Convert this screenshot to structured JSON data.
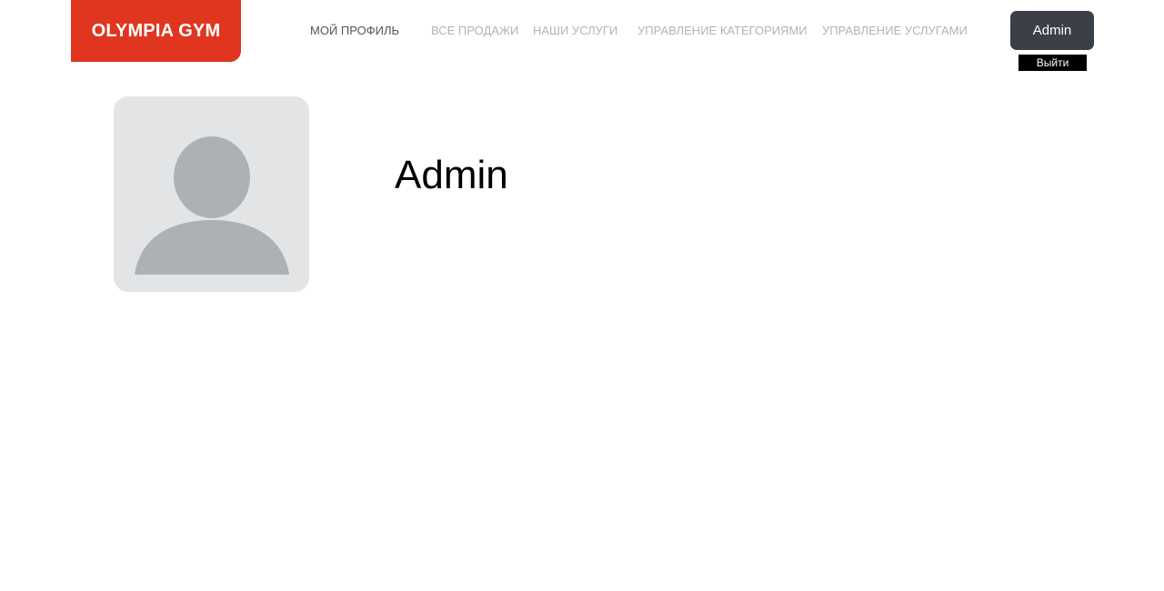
{
  "brand": {
    "name": "OLYMPIA GYM",
    "color": "#e0351f"
  },
  "nav": {
    "items": [
      {
        "label": "МОЙ ПРОФИЛЬ",
        "active": true
      },
      {
        "label": "ВСЕ ПРОДАЖИ",
        "active": false
      },
      {
        "label": "НАШИ УСЛУГИ",
        "active": false
      },
      {
        "label": "УПРАВЛЕНИЕ КАТЕГОРИЯМИ",
        "active": false
      },
      {
        "label": "УПРАВЛЕНИЕ УСЛУГАМИ",
        "active": false
      }
    ]
  },
  "user": {
    "button_label": "Admin",
    "logout_label": "Выйти"
  },
  "profile": {
    "name": "Admin",
    "avatar_icon": "user-placeholder-icon"
  },
  "colors": {
    "user_button": "#3b4047",
    "avatar_bg": "#e3e4e6",
    "avatar_figure": "#adb1b5"
  }
}
